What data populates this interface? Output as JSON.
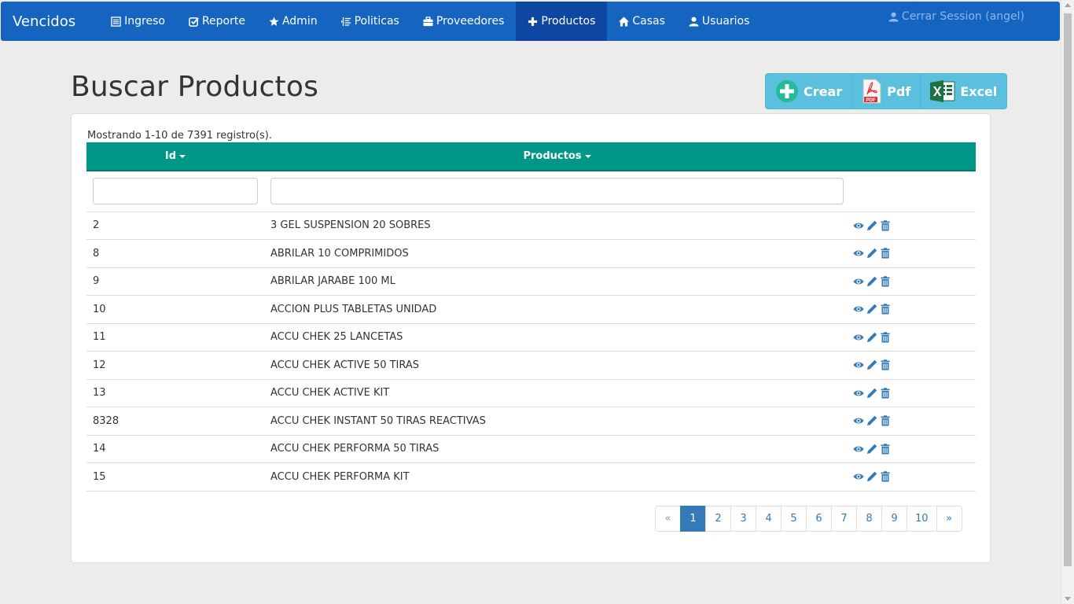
{
  "navbar": {
    "brand": "Vencidos",
    "items": [
      {
        "label": "Ingreso",
        "icon": "list-alt-icon"
      },
      {
        "label": "Reporte",
        "icon": "check-square-icon"
      },
      {
        "label": "Admin",
        "icon": "star-icon"
      },
      {
        "label": "Politicas",
        "icon": "indent-icon"
      },
      {
        "label": "Proveedores",
        "icon": "briefcase-icon"
      },
      {
        "label": "Productos",
        "icon": "plus-icon",
        "active": true
      },
      {
        "label": "Casas",
        "icon": "home-icon"
      },
      {
        "label": "Usuarios",
        "icon": "user-icon"
      }
    ],
    "logout": "Cerrar Session (angel)"
  },
  "page": {
    "title": "Buscar Productos"
  },
  "actions": {
    "create": "Crear",
    "pdf": "Pdf",
    "excel": "Excel"
  },
  "table": {
    "summary": "Mostrando 1-10 de 7391 registro(s).",
    "columns": {
      "id": "Id",
      "productos": "Productos"
    },
    "rows": [
      {
        "id": "2",
        "name": "3 GEL SUSPENSION 20 SOBRES"
      },
      {
        "id": "8",
        "name": "ABRILAR 10 COMPRIMIDOS"
      },
      {
        "id": "9",
        "name": "ABRILAR JARABE 100 ML"
      },
      {
        "id": "10",
        "name": "ACCION PLUS TABLETAS UNIDAD"
      },
      {
        "id": "11",
        "name": "ACCU CHEK 25 LANCETAS"
      },
      {
        "id": "12",
        "name": "ACCU CHEK ACTIVE 50 TIRAS"
      },
      {
        "id": "13",
        "name": "ACCU CHEK ACTIVE KIT"
      },
      {
        "id": "8328",
        "name": "ACCU CHEK INSTANT 50 TIRAS REACTIVAS"
      },
      {
        "id": "14",
        "name": "ACCU CHEK PERFORMA 50 TIRAS"
      },
      {
        "id": "15",
        "name": "ACCU CHEK PERFORMA KIT"
      }
    ]
  },
  "pagination": {
    "prev": "«",
    "pages": [
      "1",
      "2",
      "3",
      "4",
      "5",
      "6",
      "7",
      "8",
      "9",
      "10"
    ],
    "current": "1",
    "next": "»"
  },
  "colors": {
    "navbar": "#1565c0",
    "navbar_active": "#0d47a1",
    "table_header": "#009688",
    "action_bar": "#5bc0de",
    "link": "#337ab7"
  }
}
